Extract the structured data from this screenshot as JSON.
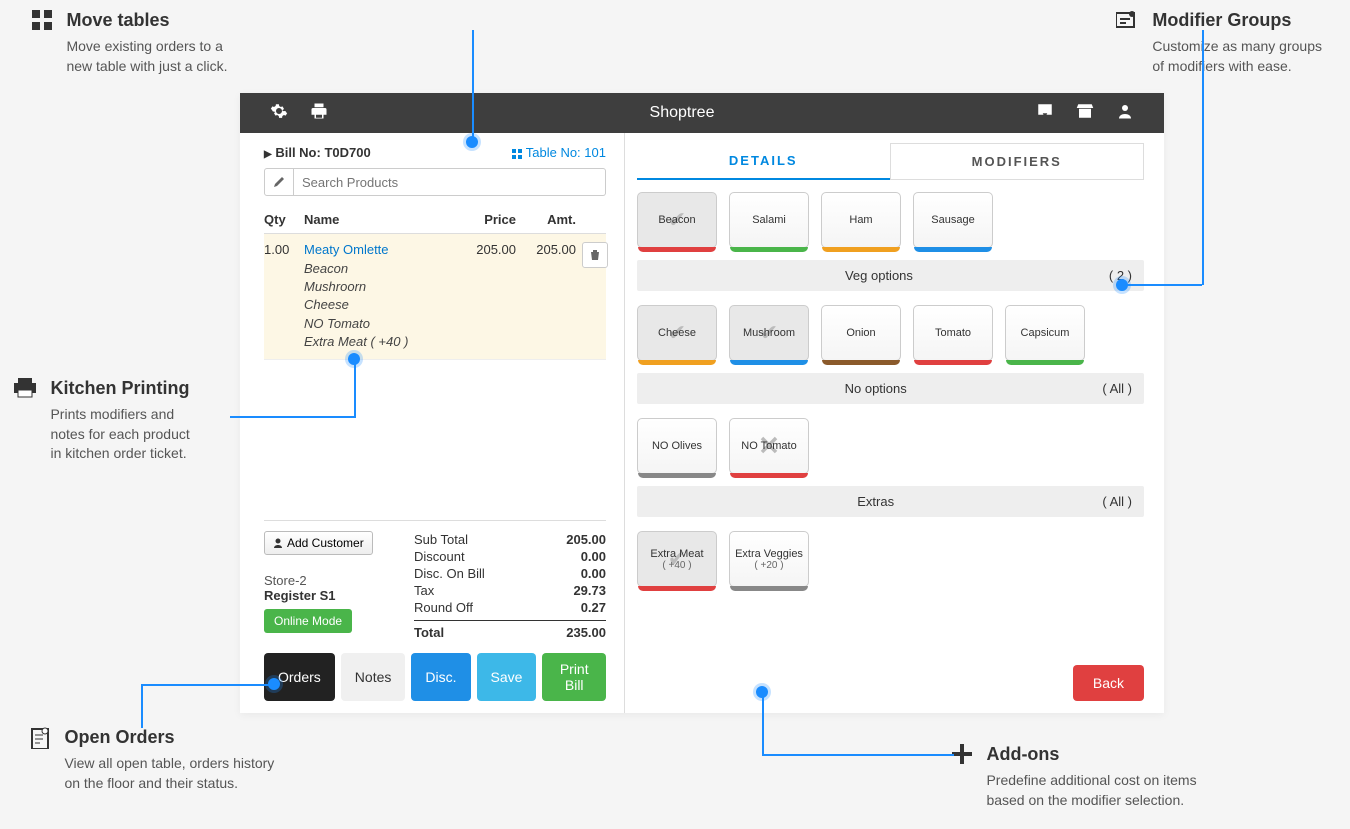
{
  "callouts": {
    "move_tables": {
      "title": "Move tables",
      "desc1": "Move existing orders to a",
      "desc2": "new table with just a click."
    },
    "modifier_groups": {
      "title": "Modifier Groups",
      "desc1": "Customize as many groups",
      "desc2": "of modifiers with ease."
    },
    "kitchen_printing": {
      "title": "Kitchen Printing",
      "desc1": "Prints modifiers and",
      "desc2": "notes for each product",
      "desc3": "in kitchen order ticket."
    },
    "open_orders": {
      "title": "Open Orders",
      "desc1": "View all open table, orders history",
      "desc2": "on the floor and their status."
    },
    "addons": {
      "title": "Add-ons",
      "desc1": "Predefine additional cost on items",
      "desc2": "based on the modifier selection."
    }
  },
  "header": {
    "brand": "Shoptree"
  },
  "bill": {
    "label": "Bill No:",
    "number": "T0D700",
    "table_label": "Table No:",
    "table_number": "101"
  },
  "search": {
    "placeholder": "Search Products"
  },
  "table_headers": {
    "qty": "Qty",
    "name": "Name",
    "price": "Price",
    "amt": "Amt."
  },
  "order_item": {
    "qty": "1.00",
    "name": "Meaty Omlette",
    "price": "205.00",
    "amount": "205.00",
    "mods": [
      "Beacon",
      "Mushroorn",
      "Cheese",
      "NO Tomato",
      "Extra Meat ( +40 )"
    ]
  },
  "customer_btn": "Add Customer",
  "store": "Store-2",
  "register": "Register S1",
  "online_mode": "Online Mode",
  "totals": {
    "subtotal_label": "Sub Total",
    "subtotal": "205.00",
    "discount_label": "Discount",
    "discount": "0.00",
    "disc_bill_label": "Disc. On Bill",
    "disc_bill": "0.00",
    "tax_label": "Tax",
    "tax": "29.73",
    "round_label": "Round Off",
    "round": "0.27",
    "total_label": "Total",
    "total": "235.00"
  },
  "actions": {
    "orders": "Orders",
    "notes": "Notes",
    "disc": "Disc.",
    "save": "Save",
    "print": "Print Bill"
  },
  "tabs": {
    "details": "DETAILS",
    "modifiers": "MODIFIERS"
  },
  "mod_sections": {
    "meat": [
      {
        "label": "Beacon",
        "bar": "bar-red",
        "selected": true
      },
      {
        "label": "Salami",
        "bar": "bar-green"
      },
      {
        "label": "Ham",
        "bar": "bar-orange"
      },
      {
        "label": "Sausage",
        "bar": "bar-blue"
      }
    ],
    "veg_header": {
      "title": "Veg options",
      "count": "( 2 )"
    },
    "veg": [
      {
        "label": "Cheese",
        "bar": "bar-orange",
        "selected": true
      },
      {
        "label": "Mushroom",
        "bar": "bar-blue",
        "selected": true
      },
      {
        "label": "Onion",
        "bar": "bar-brown"
      },
      {
        "label": "Tomato",
        "bar": "bar-red"
      },
      {
        "label": "Capsicum",
        "bar": "bar-green"
      }
    ],
    "no_header": {
      "title": "No options",
      "count": "( All )"
    },
    "no": [
      {
        "label": "NO Olives",
        "bar": "bar-gray"
      },
      {
        "label": "NO Tomato",
        "bar": "bar-red",
        "removed": true
      }
    ],
    "extras_header": {
      "title": "Extras",
      "count": "( All )"
    },
    "extras": [
      {
        "label": "Extra Meat",
        "price": "( +40 )",
        "bar": "bar-red",
        "selected": true
      },
      {
        "label": "Extra Veggies",
        "price": "( +20 )",
        "bar": "bar-gray"
      }
    ]
  },
  "back_btn": "Back"
}
